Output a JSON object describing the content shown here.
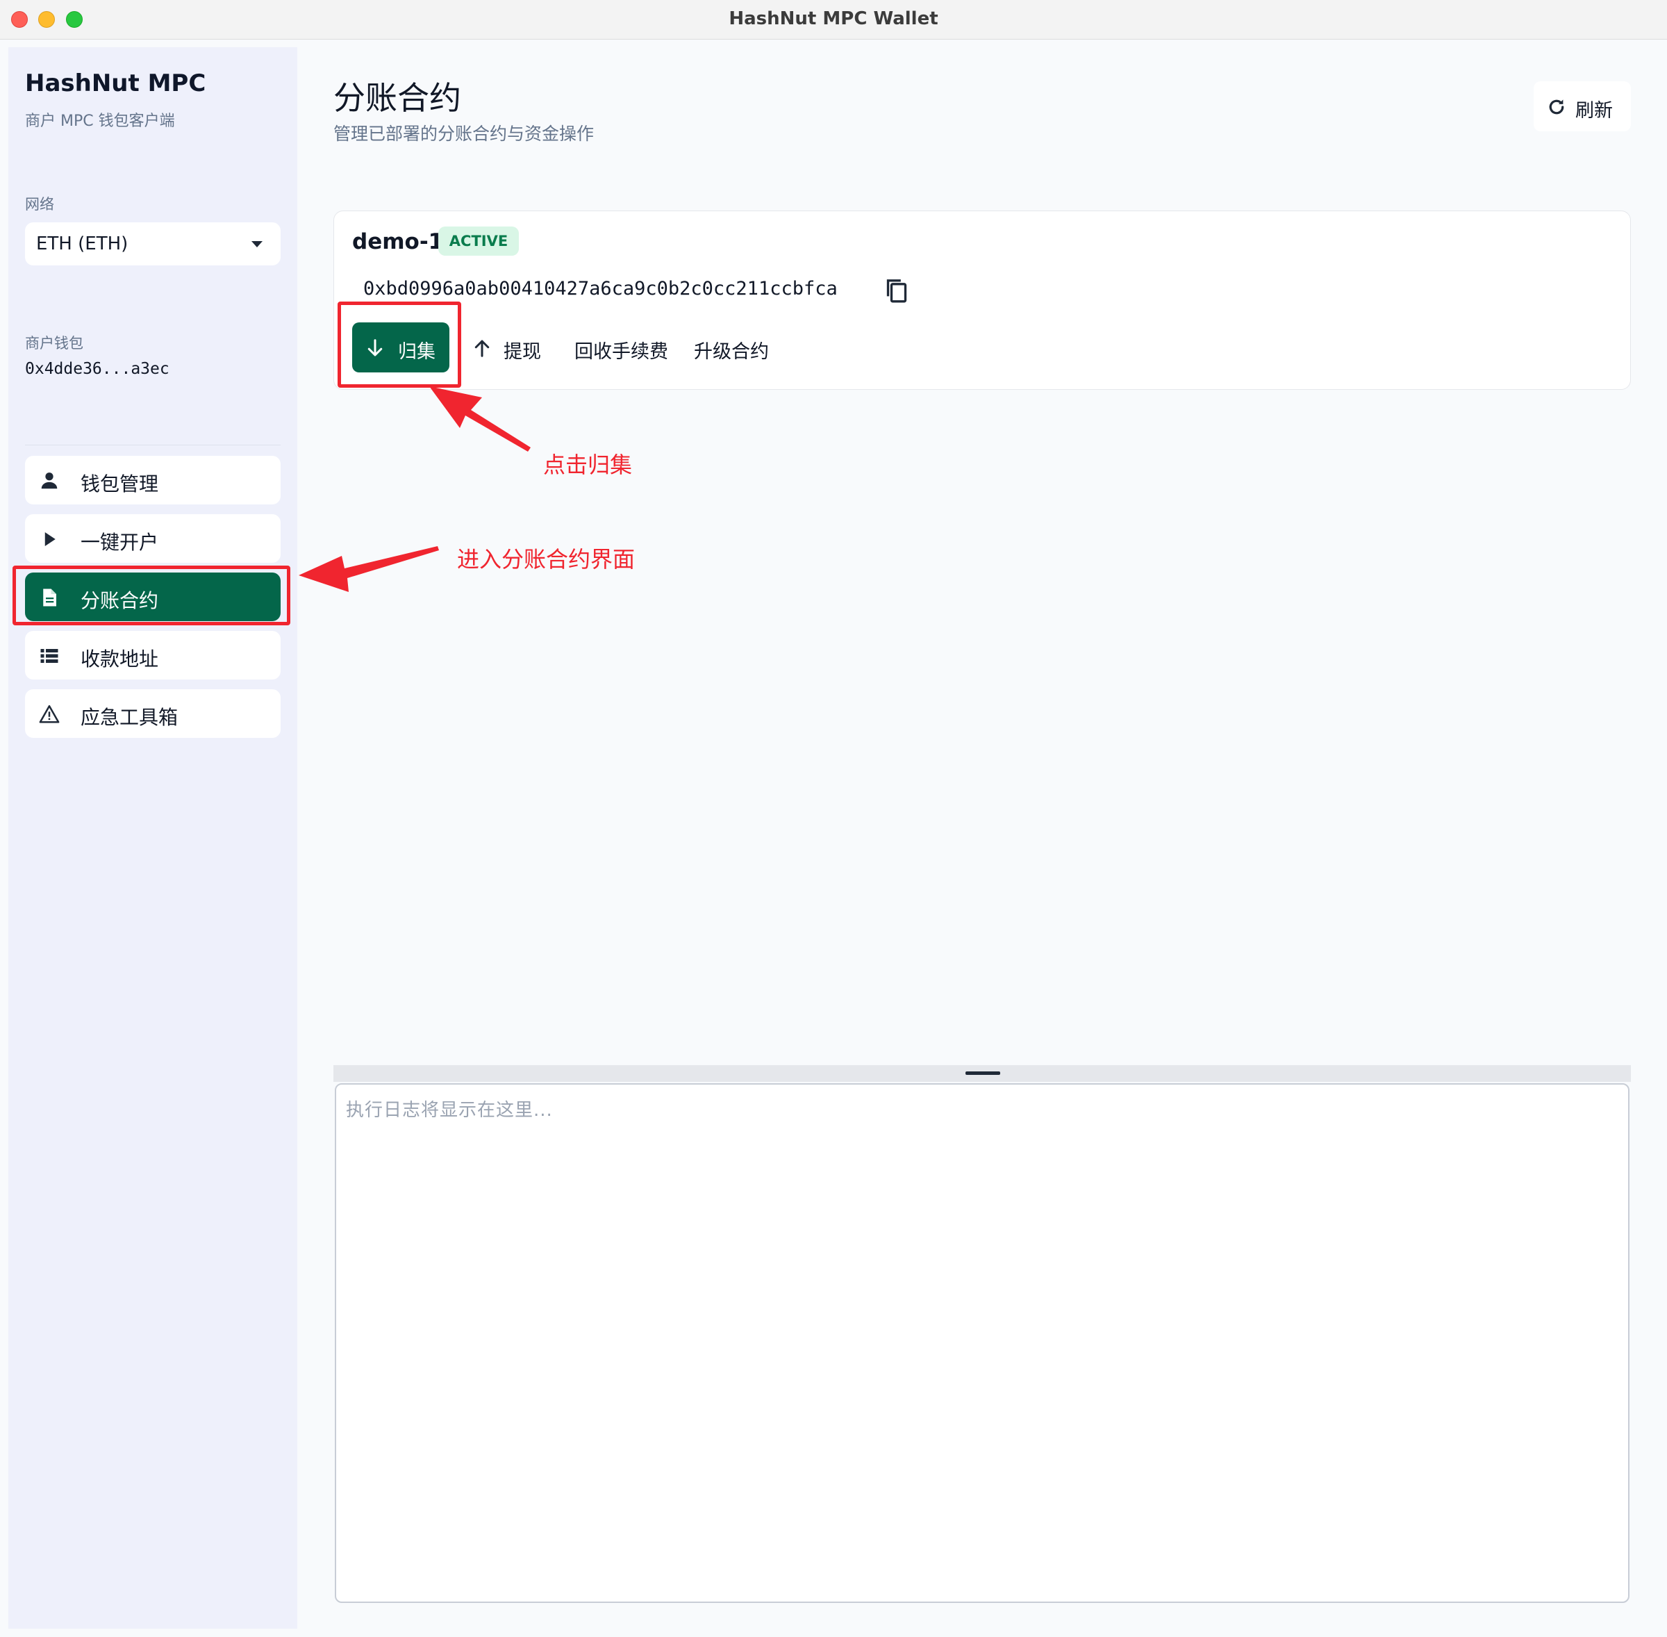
{
  "window": {
    "title": "HashNut MPC Wallet"
  },
  "sidebar": {
    "brand": "HashNut MPC",
    "brand_subtitle": "商户 MPC 钱包客户端",
    "network_label": "网络",
    "network_value": "ETH (ETH)",
    "wallet_label": "商户钱包",
    "wallet_address": "0x4dde36...a3ec",
    "nav": [
      {
        "label": "钱包管理",
        "icon": "user-icon",
        "active": false
      },
      {
        "label": "一键开户",
        "icon": "play-icon",
        "active": false
      },
      {
        "label": "分账合约",
        "icon": "document-icon",
        "active": true
      },
      {
        "label": "收款地址",
        "icon": "list-icon",
        "active": false
      },
      {
        "label": "应急工具箱",
        "icon": "warning-icon",
        "active": false
      }
    ]
  },
  "main": {
    "title": "分账合约",
    "subtitle": "管理已部署的分账合约与资金操作",
    "refresh_label": "刷新",
    "contract": {
      "name": "demo-1",
      "status": "ACTIVE",
      "address": "0xbd0996a0ab00410427a6ca9c0b2c0cc211ccbfca",
      "actions": {
        "collect": "归集",
        "withdraw": "提现",
        "reclaim_fee": "回收手续费",
        "upgrade": "升级合约"
      }
    },
    "log_placeholder": "执行日志将显示在这里..."
  },
  "annotations": {
    "click_collect": "点击归集",
    "enter_contract_page": "进入分账合约界面"
  },
  "colors": {
    "primary": "#04664a",
    "annotation": "#f0252f",
    "badge_bg": "#d9f6e6",
    "sidebar_bg": "#eef0fb"
  }
}
